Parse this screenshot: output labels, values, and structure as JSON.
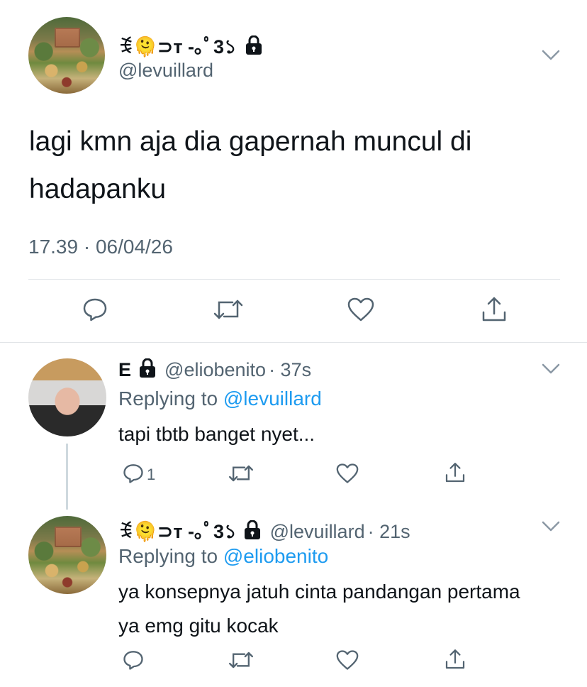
{
  "main_tweet": {
    "display_name": "ꉂ🫠⊃ᴛ -｡ﾟ3১",
    "handle": "@levuillard",
    "text": "lagi kmn aja dia gapernah muncul di hadapanku",
    "timestamp": "17.39 · 06/04/26",
    "avatar_icon": "painting-avatar",
    "locked_icon": "lock-icon"
  },
  "actions": {
    "reply_icon": "reply-icon",
    "retweet_icon": "retweet-icon",
    "like_icon": "heart-icon",
    "share_icon": "share-icon"
  },
  "replies": [
    {
      "display_name": "E",
      "handle": "@eliobenito",
      "time": "· 37s",
      "replying_label": "Replying to",
      "replying_to": "@levuillard",
      "text": "tapi tbtb banget nyet...",
      "reply_count": "1"
    },
    {
      "display_name": "ꉂ🫠⊃ᴛ -｡ﾟ3১",
      "handle": "@levuillard",
      "time": "· 21s",
      "replying_label": "Replying to",
      "replying_to": "@eliobenito",
      "text": "ya konsepnya jatuh cinta pandangan pertama ya emg gitu kocak",
      "reply_count": ""
    }
  ],
  "colors": {
    "text": "#0f1419",
    "secondary": "#536471",
    "mention": "#1d9bf0",
    "divider": "#e1e4e8"
  }
}
